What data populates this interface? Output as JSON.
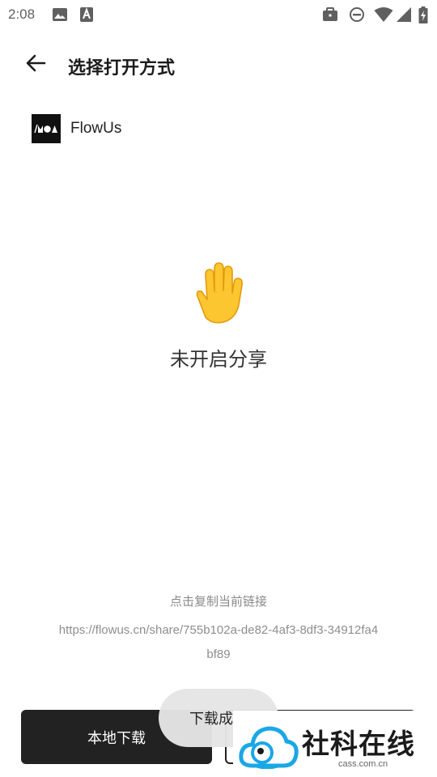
{
  "status_bar": {
    "time": "2:08",
    "left_icons": [
      "image-icon",
      "text-a-icon"
    ],
    "right_icons": [
      "briefcase-icon",
      "do-not-disturb-icon",
      "wifi-icon",
      "signal-icon",
      "battery-charging-icon"
    ]
  },
  "app_bar": {
    "title": "选择打开方式",
    "back_icon": "arrow-back-icon"
  },
  "apps": [
    {
      "name": "FlowUs"
    }
  ],
  "empty_state": {
    "icon": "raised-hand-icon",
    "text": "未开启分享"
  },
  "share": {
    "copy_hint": "点击复制当前链接",
    "link": "https://flowus.cn/share/755b102a-de82-4af3-8df3-34912fa4bf89"
  },
  "buttons": {
    "local_download": "本地下载"
  },
  "toast": {
    "text": "下载成功"
  },
  "watermark": {
    "title": "社科在线",
    "subtitle": "cass.com.cn"
  },
  "colors": {
    "primary_button": "#222222",
    "hint_text": "#8a8a8a",
    "watermark_blue": "#1aa7e6"
  }
}
